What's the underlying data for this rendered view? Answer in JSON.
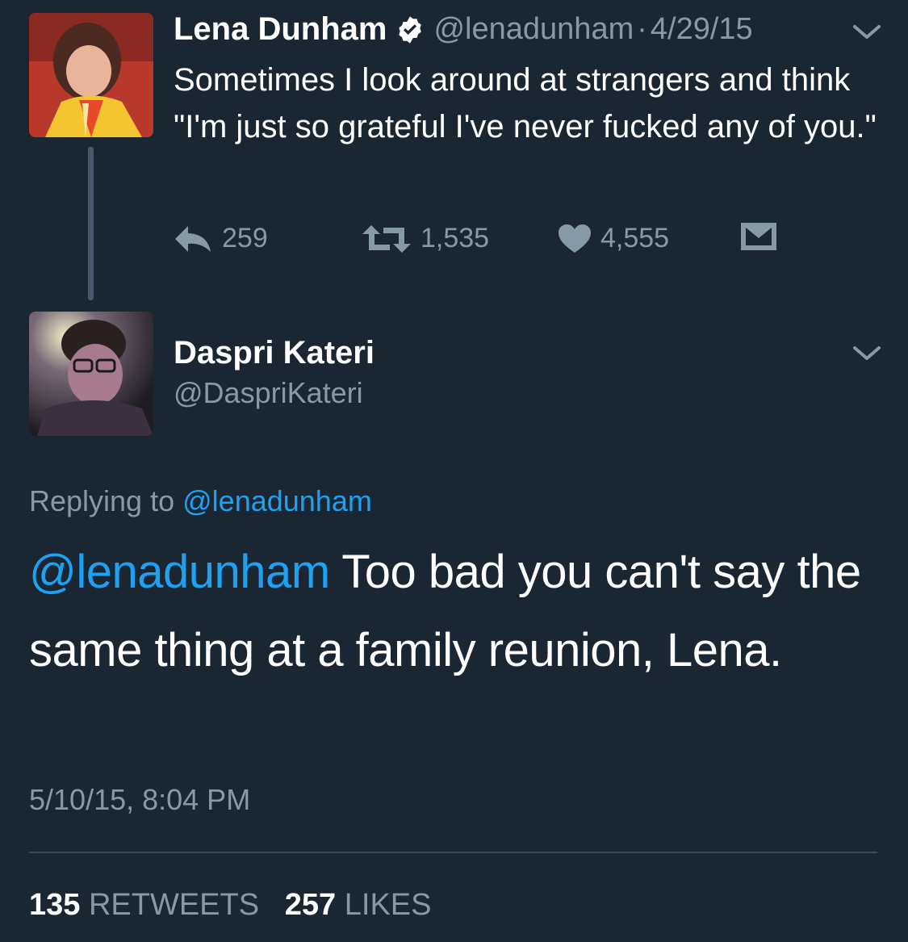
{
  "parent_tweet": {
    "author_name": "Lena Dunham",
    "handle": "@lenadunham",
    "separator": "·",
    "date": "4/29/15",
    "verified_icon": "verified-badge-icon",
    "text": "Sometimes I look around at strangers and think \"I'm just so grateful I've never fucked any of you.\"",
    "actions": {
      "reply_count": "259",
      "retweet_count": "1,535",
      "like_count": "4,555"
    }
  },
  "reply_tweet": {
    "author_name": "Daspri Kateri",
    "handle": "@DaspriKateri",
    "replying_label": "Replying to",
    "replying_to": "@lenadunham",
    "mention": "@lenadunham",
    "text": " Too bad you can't say the same thing at a family reunion, Lena.",
    "timestamp": "5/10/15, 8:04 PM",
    "retweets_count": "135",
    "retweets_label": "RETWEETS",
    "likes_count": "257",
    "likes_label": "LIKES"
  },
  "colors": {
    "background": "#1b2633",
    "muted": "#8899a6",
    "link": "#1da1f2",
    "verified": "#ffffff"
  }
}
